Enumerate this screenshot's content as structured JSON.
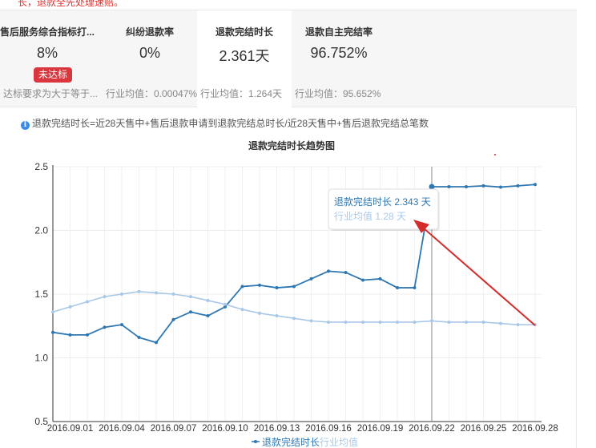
{
  "top_strip_text": "长，退款全先处理速赔。",
  "metrics": [
    {
      "title": "售后服务综合指标打...",
      "value": "8%",
      "badge": "未达标",
      "sub": "达标要求为大于等于..."
    },
    {
      "title": "纠纷退款率",
      "value": "0%",
      "sub": "行业均值：0.00047%"
    },
    {
      "title": "退款完结时长",
      "value": "2.361天",
      "sub": "行业均值：1.264天",
      "active": true
    },
    {
      "title": "退款自主完结率",
      "value": "96.752%",
      "sub": "行业均值：95.652%"
    }
  ],
  "formula": "退款完结时长=近28天售中+售后退款申请到退款完结总时长/近28天售中+售后退款完结总笔数",
  "colors": {
    "series_main": "#2e77b1",
    "series_avg": "#a9c8e8",
    "arrow": "#d42b2b",
    "badge": "#d9363e"
  },
  "chart_data": {
    "type": "line",
    "title": "退款完结时长趋势图",
    "ylim": [
      0.5,
      2.5
    ],
    "yticks": [
      "0.5",
      "1.0",
      "1.5",
      "2.0",
      "2.5"
    ],
    "x_ticks": [
      "2016.09.01",
      "2016.09.04",
      "2016.09.07",
      "2016.09.10",
      "2016.09.13",
      "2016.09.16",
      "2016.09.19",
      "2016.09.22",
      "2016.09.25",
      "2016.09.28"
    ],
    "x": [
      "2016.08.31",
      "2016.09.01",
      "2016.09.02",
      "2016.09.03",
      "2016.09.04",
      "2016.09.05",
      "2016.09.06",
      "2016.09.07",
      "2016.09.08",
      "2016.09.09",
      "2016.09.10",
      "2016.09.11",
      "2016.09.12",
      "2016.09.13",
      "2016.09.14",
      "2016.09.15",
      "2016.09.16",
      "2016.09.17",
      "2016.09.18",
      "2016.09.19",
      "2016.09.20",
      "2016.09.21",
      "2016.09.22",
      "2016.09.23",
      "2016.09.24",
      "2016.09.25",
      "2016.09.26",
      "2016.09.27",
      "2016.09.28"
    ],
    "series": [
      {
        "name": "退款完结时长",
        "values": [
          1.2,
          1.18,
          1.18,
          1.24,
          1.26,
          1.16,
          1.12,
          1.3,
          1.36,
          1.33,
          1.4,
          1.56,
          1.57,
          1.55,
          1.56,
          1.62,
          1.68,
          1.67,
          1.61,
          1.62,
          1.55,
          1.55,
          2.343,
          2.343,
          2.343,
          2.35,
          2.34,
          2.35,
          2.36
        ]
      },
      {
        "name": "行业均值",
        "values": [
          1.36,
          1.4,
          1.44,
          1.48,
          1.5,
          1.52,
          1.51,
          1.5,
          1.48,
          1.45,
          1.42,
          1.38,
          1.35,
          1.33,
          1.31,
          1.29,
          1.28,
          1.28,
          1.28,
          1.28,
          1.28,
          1.28,
          1.29,
          1.28,
          1.28,
          1.28,
          1.27,
          1.26,
          1.26
        ]
      }
    ],
    "tooltip": {
      "line1": "退款完结时长  2.343 天",
      "line2": "行业均值  1.28 天",
      "index": 22
    },
    "legend": [
      "退款完结时长",
      "行业均值"
    ]
  }
}
